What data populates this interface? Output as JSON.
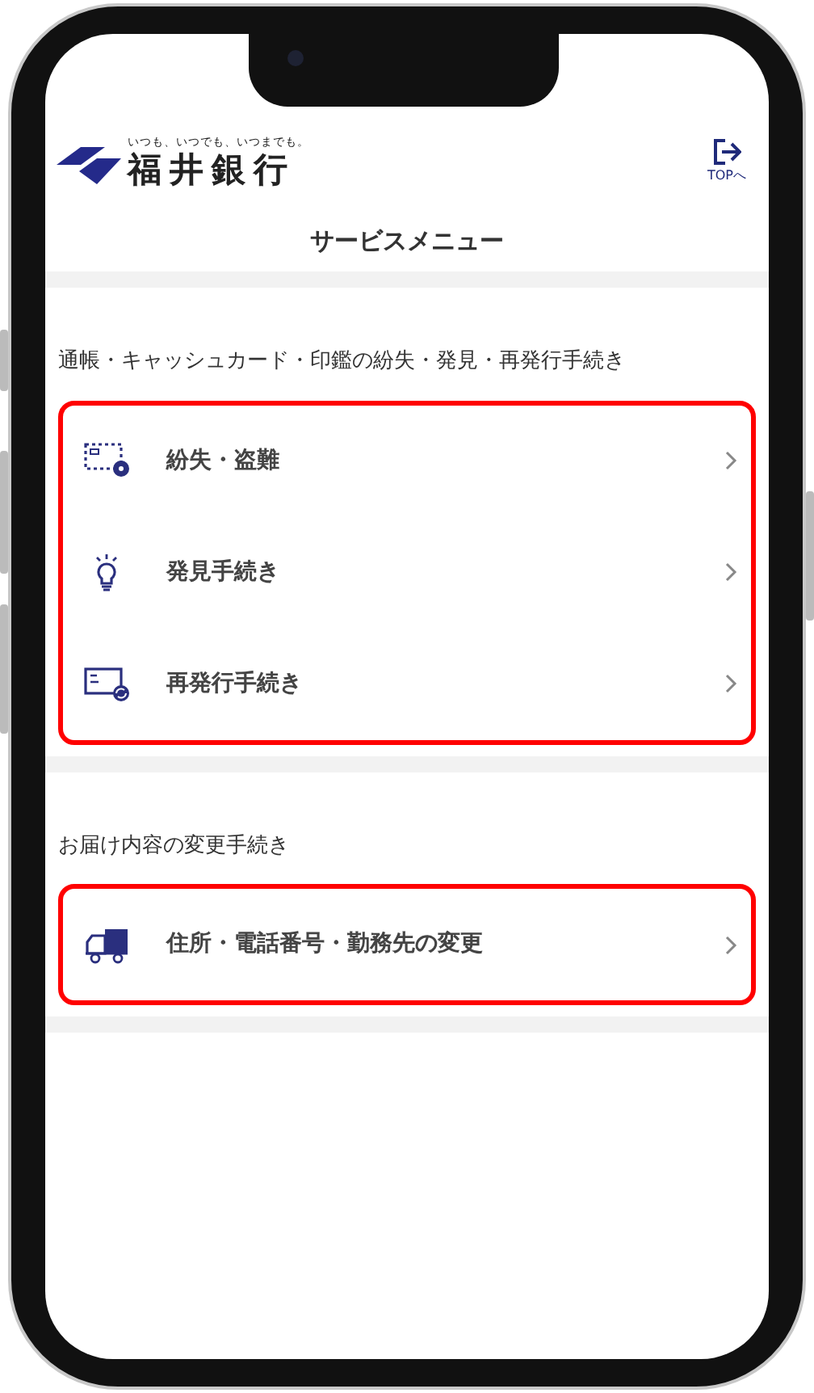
{
  "header": {
    "tagline": "いつも、いつでも、いつまでも。",
    "bank_name": "福井銀行",
    "top_link": "TOPへ"
  },
  "title": "サービスメニュー",
  "sections": [
    {
      "heading": "通帳・キャッシュカード・印鑑の紛失・発見・再発行手続き",
      "highlighted": true,
      "items": [
        {
          "label": "紛失・盗難",
          "kind": "lost"
        },
        {
          "label": "発見手続き",
          "kind": "found"
        },
        {
          "label": "再発行手続き",
          "kind": "reissue"
        }
      ]
    },
    {
      "heading": "お届け内容の変更手続き",
      "highlighted": true,
      "items": [
        {
          "label": "住所・電話番号・勤務先の変更",
          "kind": "move"
        }
      ]
    }
  ]
}
